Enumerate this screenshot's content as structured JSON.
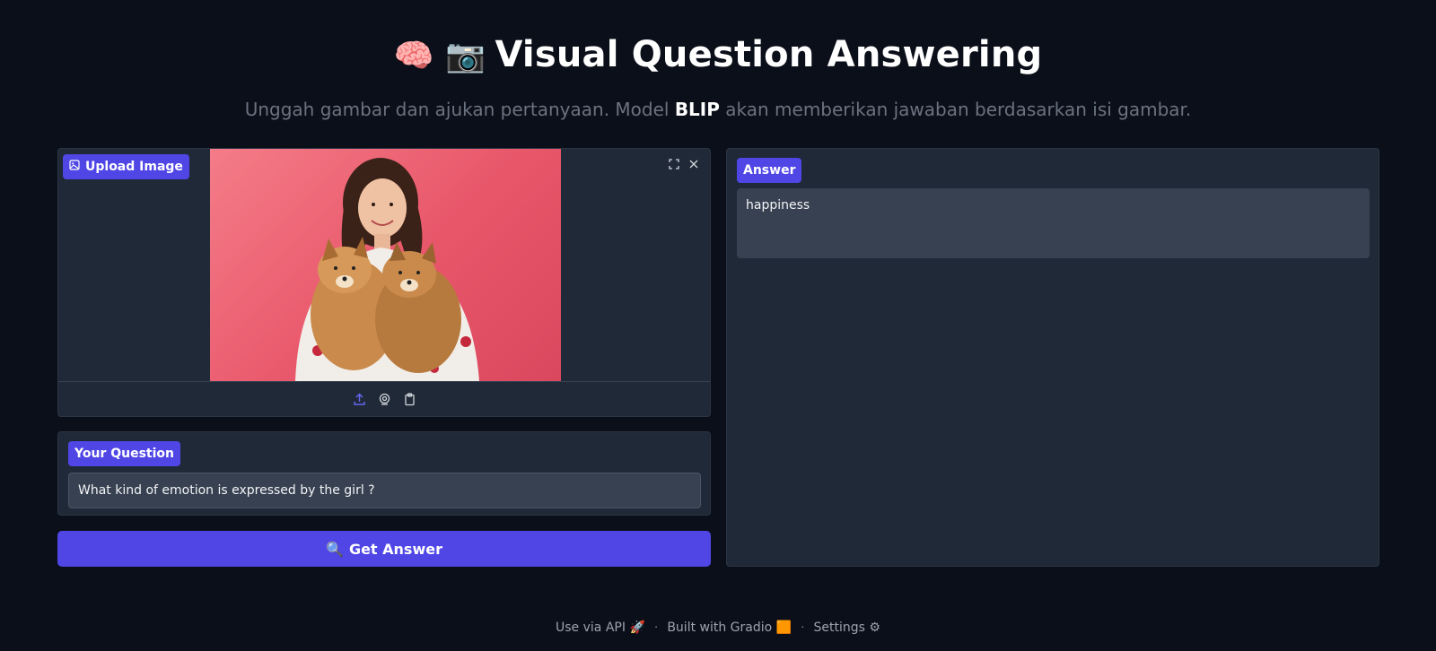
{
  "header": {
    "title_emoji": "🧠 📷",
    "title": "Visual Question Answering",
    "subtitle_before": "Unggah gambar dan ajukan pertanyaan. Model ",
    "subtitle_bold": "BLIP",
    "subtitle_after": " akan memberikan jawaban berdasarkan isi gambar."
  },
  "image_input": {
    "label": "Upload Image",
    "icons": [
      "fullscreen-icon",
      "close-icon",
      "upload-icon",
      "webcam-icon",
      "clipboard-icon"
    ]
  },
  "question": {
    "label": "Your Question",
    "value": "What kind of emotion is expressed by the girl ?"
  },
  "submit": {
    "icon": "🔍",
    "label": "Get Answer"
  },
  "answer": {
    "label": "Answer",
    "value": "happiness"
  },
  "footer": {
    "api_label": "Use via API",
    "api_icon": "🚀",
    "built_label": "Built with Gradio",
    "built_icon": "🟧",
    "settings_label": "Settings",
    "settings_icon": "⚙",
    "separator": "·"
  },
  "colors": {
    "background": "#0b0f19",
    "panel": "#1f2937",
    "accent": "#4f46e5",
    "input": "#374151"
  }
}
